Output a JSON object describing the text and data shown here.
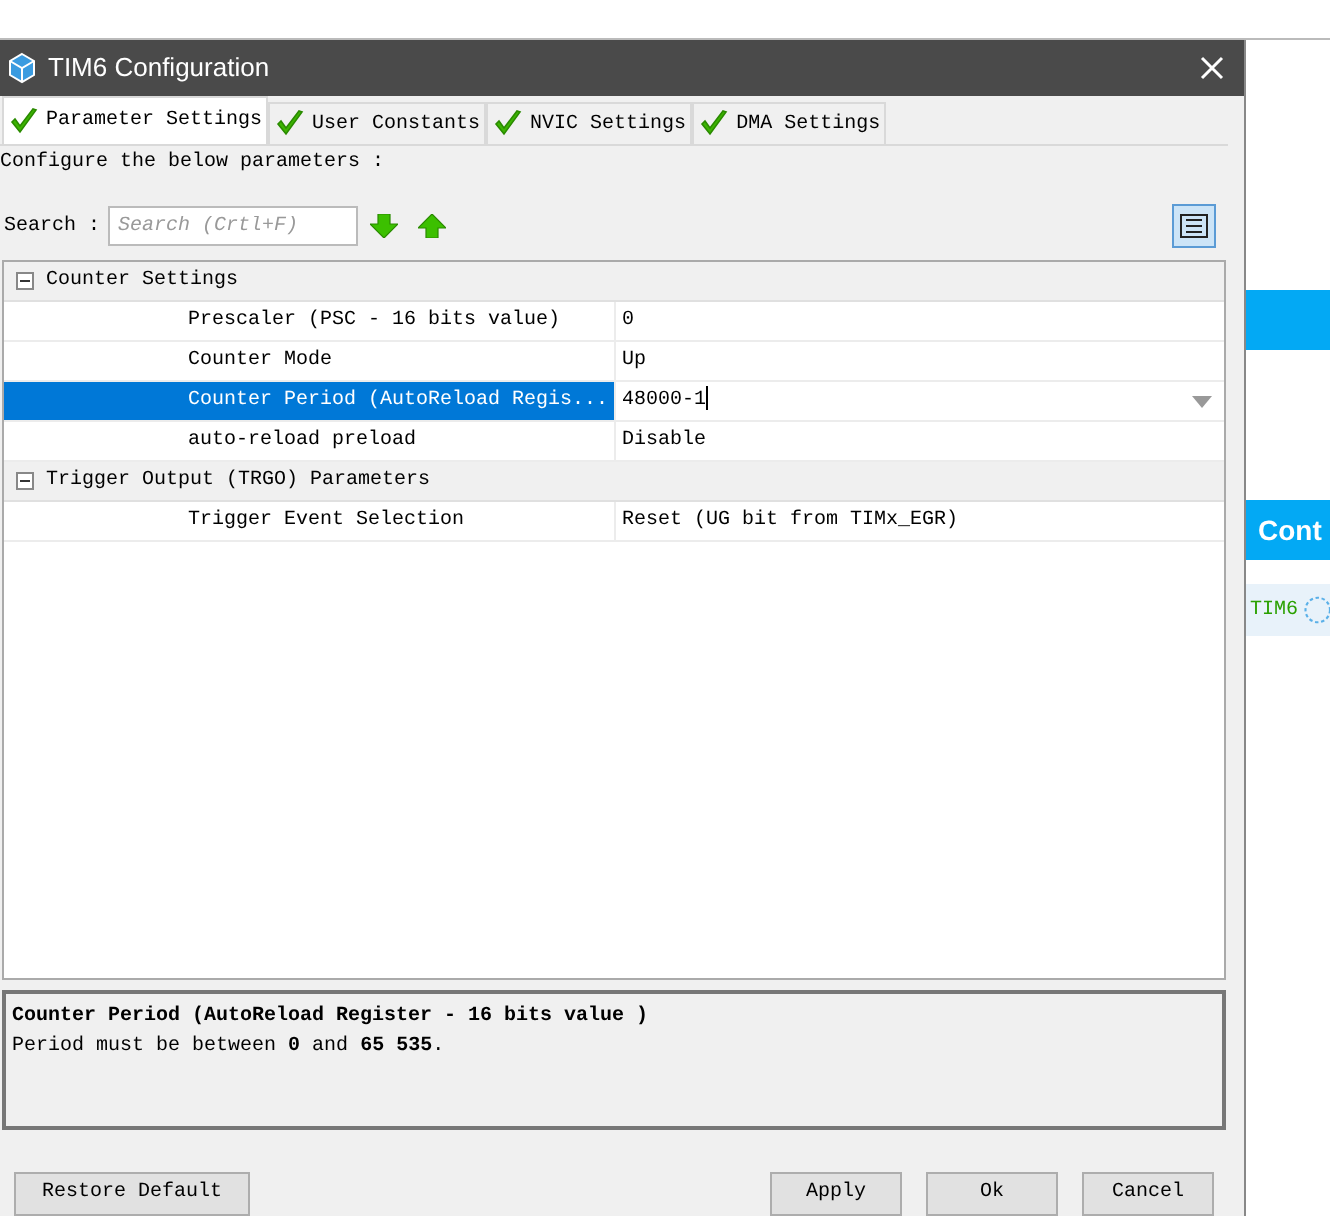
{
  "window": {
    "title": "TIM6 Configuration"
  },
  "tabs": [
    {
      "label": "Parameter Settings",
      "selected": true
    },
    {
      "label": "User Constants",
      "selected": false
    },
    {
      "label": "NVIC Settings",
      "selected": false
    },
    {
      "label": "DMA Settings",
      "selected": false
    }
  ],
  "intro": "Configure the below parameters :",
  "search": {
    "label": "Search :",
    "placeholder": "Search (Crtl+F)"
  },
  "groups": [
    {
      "title": "Counter Settings",
      "expanded": true,
      "rows": [
        {
          "name": "Prescaler (PSC - 16 bits value)",
          "value": "0",
          "selected": false
        },
        {
          "name": "Counter Mode",
          "value": "Up",
          "selected": false
        },
        {
          "name": "Counter Period (AutoReload Regis...",
          "value": "48000-1",
          "selected": true
        },
        {
          "name": "auto-reload preload",
          "value": "Disable",
          "selected": false
        }
      ]
    },
    {
      "title": "Trigger Output (TRGO) Parameters",
      "expanded": true,
      "rows": [
        {
          "name": "Trigger Event Selection",
          "value": "Reset (UG bit from TIMx_EGR)",
          "selected": false
        }
      ]
    }
  ],
  "description": {
    "title": "Counter Period (AutoReload Register - 16 bits value )",
    "text": "Period must be between **0** and **65 535**."
  },
  "buttons": [
    {
      "label": "Restore Default"
    },
    {
      "label": "Apply"
    },
    {
      "label": "Ok"
    },
    {
      "label": "Cancel"
    }
  ],
  "background_app": {
    "button": "Cont",
    "tag": "TIM6"
  }
}
